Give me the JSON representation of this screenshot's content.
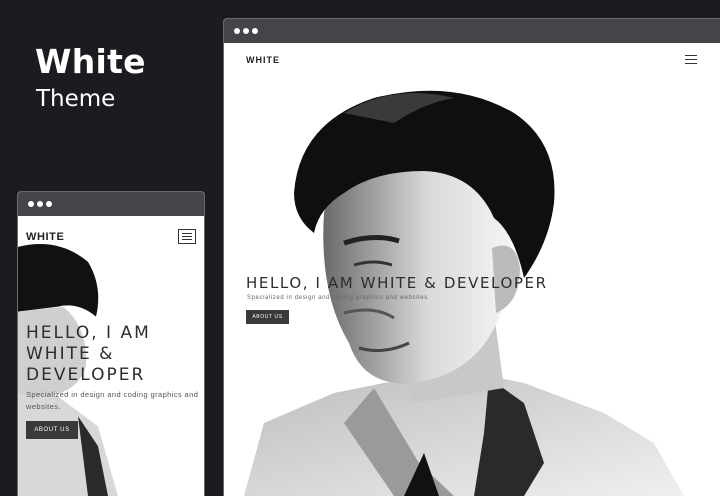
{
  "brand": {
    "title": "White",
    "subtitle": "Theme"
  },
  "desktop": {
    "logo": "WHITE",
    "hero_heading": "HELLO, I AM WHITE & DEVELOPER",
    "hero_caption": "Specialized in design and coding graphics and websites.",
    "button_label": "ABOUT US"
  },
  "mobile": {
    "logo": "WHITE",
    "hero_heading_lines": [
      "HELLO, I AM",
      "WHITE &",
      "DEVELOPER"
    ],
    "hero_caption": "Specialized in design and coding graphics and websites.",
    "button_label": "ABOUT US"
  },
  "colors": {
    "background": "#1c1b20",
    "titlebar": "#454448",
    "button": "#3a3a3c"
  },
  "icons": [
    "window-dot-icon",
    "hamburger-menu-icon",
    "portrait-photo"
  ]
}
